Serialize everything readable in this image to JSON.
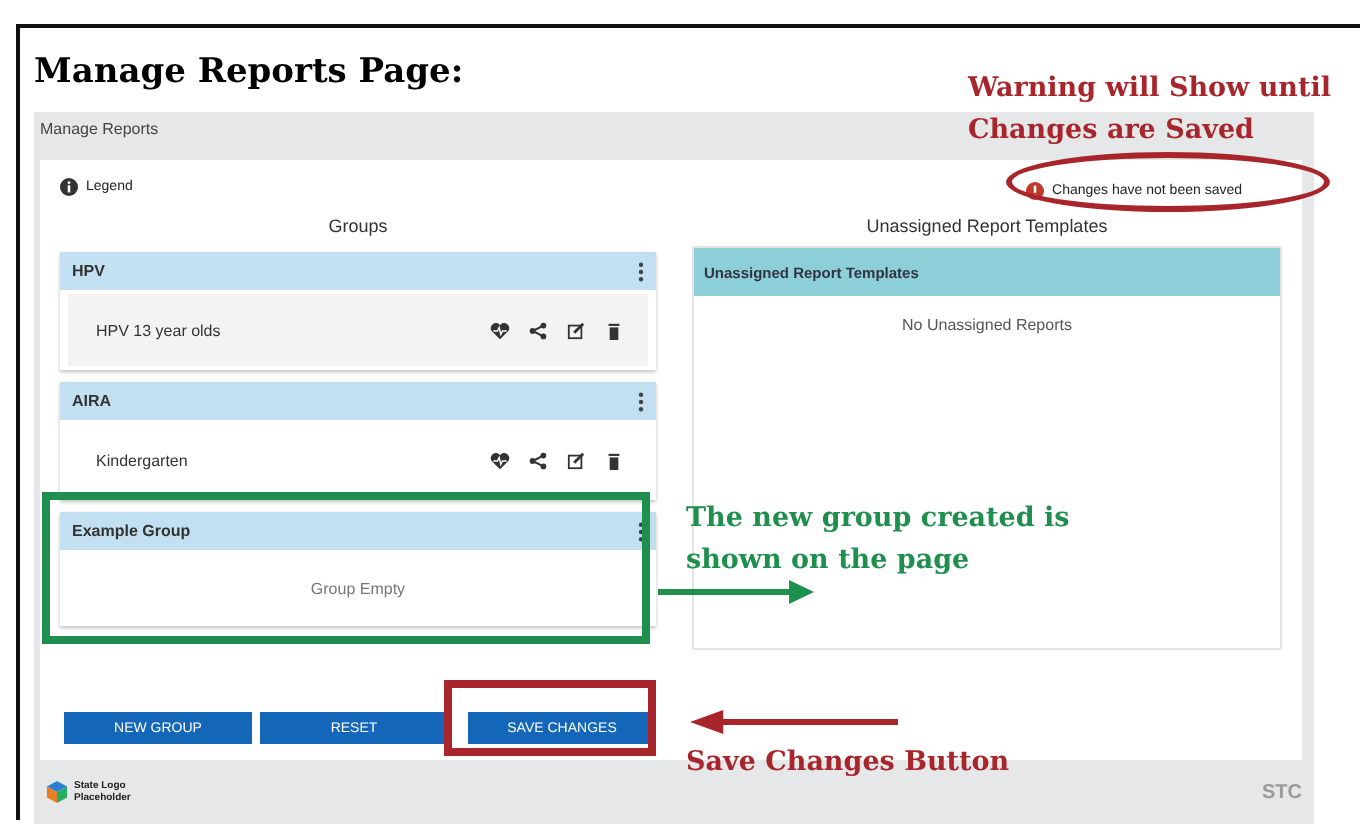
{
  "title": "Manage Reports Page:",
  "app": {
    "header": "Manage Reports",
    "legend": "Legend",
    "warning": "Changes have not been saved",
    "groups_heading": "Groups",
    "unassigned_heading": "Unassigned Report Templates",
    "groups": [
      {
        "name": "HPV",
        "reports": [
          "HPV 13 year olds"
        ]
      },
      {
        "name": "AIRA",
        "reports": [
          "Kindergarten"
        ]
      },
      {
        "name": "Example Group",
        "empty_text": "Group Empty"
      }
    ],
    "unassigned_panel": {
      "title": "Unassigned Report Templates",
      "empty_text": "No Unassigned Reports"
    },
    "buttons": [
      "NEW GROUP",
      "RESET",
      "SAVE CHANGES"
    ],
    "footer": {
      "logo_text": "State Logo Placeholder",
      "brand": "STC"
    }
  },
  "annotations": [
    {
      "kind": "warning",
      "text": "Warning will Show until Changes are Saved",
      "color": "#a8262b"
    },
    {
      "kind": "new-group",
      "text": "The new group created is shown on the page",
      "color": "#1f8f4e"
    },
    {
      "kind": "save-button",
      "text": "Save Changes Button",
      "color": "#a8262b"
    }
  ]
}
